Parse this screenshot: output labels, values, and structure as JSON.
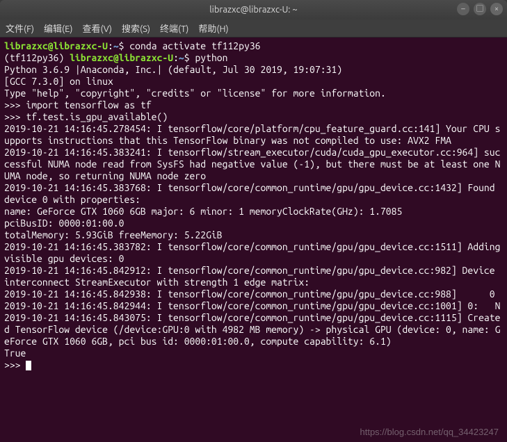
{
  "window": {
    "title": "librazxc@librazxc-U: ~"
  },
  "menu": {
    "file": "文件(F)",
    "edit": "编辑(E)",
    "view": "查看(V)",
    "search": "搜索(S)",
    "terminal": "终端(T)",
    "help": "帮助(H)"
  },
  "prompt": {
    "user_host": "librazxc@librazxc-U",
    "sep": ":",
    "path": "~",
    "dollar": "$",
    "env_prefix": "(tf112py36) "
  },
  "commands": {
    "cmd1": "conda activate tf112py36",
    "cmd2": "python"
  },
  "python": {
    "line1": "Python 3.6.9 |Anaconda, Inc.| (default, Jul 30 2019, 19:07:31)",
    "line2": "[GCC 7.3.0] on linux",
    "line3": "Type \"help\", \"copyright\", \"credits\" or \"license\" for more information.",
    "stmt1": ">>> import tensorflow as tf",
    "stmt2": ">>> tf.test.is_gpu_available()"
  },
  "log": {
    "l1": "2019-10-21 14:16:45.278454: I tensorflow/core/platform/cpu_feature_guard.cc:141] Your CPU supports instructions that this TensorFlow binary was not compiled to use: AVX2 FMA",
    "l2": "2019-10-21 14:16:45.383241: I tensorflow/stream_executor/cuda/cuda_gpu_executor.cc:964] successful NUMA node read from SysFS had negative value (-1), but there must be at least one NUMA node, so returning NUMA node zero",
    "l3": "2019-10-21 14:16:45.383768: I tensorflow/core/common_runtime/gpu/gpu_device.cc:1432] Found device 0 with properties:",
    "l4": "name: GeForce GTX 1060 6GB major: 6 minor: 1 memoryClockRate(GHz): 1.7085",
    "l5": "pciBusID: 0000:01:00.0",
    "l6": "totalMemory: 5.93GiB freeMemory: 5.22GiB",
    "l7": "2019-10-21 14:16:45.383782: I tensorflow/core/common_runtime/gpu/gpu_device.cc:1511] Adding visible gpu devices: 0",
    "l8": "2019-10-21 14:16:45.842912: I tensorflow/core/common_runtime/gpu/gpu_device.cc:982] Device interconnect StreamExecutor with strength 1 edge matrix:",
    "l9": "2019-10-21 14:16:45.842938: I tensorflow/core/common_runtime/gpu/gpu_device.cc:988]      0",
    "l10": "2019-10-21 14:16:45.842944: I tensorflow/core/common_runtime/gpu/gpu_device.cc:1001] 0:   N",
    "l11": "2019-10-21 14:16:45.843075: I tensorflow/core/common_runtime/gpu/gpu_device.cc:1115] Created TensorFlow device (/device:GPU:0 with 4982 MB memory) -> physical GPU (device: 0, name: GeForce GTX 1060 6GB, pci bus id: 0000:01:00.0, compute capability: 6.1)",
    "result": "True",
    "next_prompt": ">>> "
  },
  "watermark": "https://blog.csdn.net/qq_34423247"
}
